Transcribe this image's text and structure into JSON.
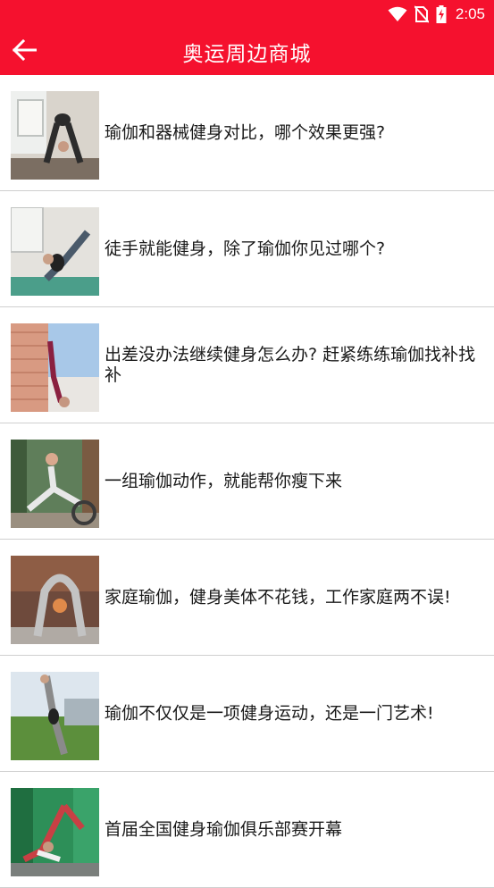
{
  "status": {
    "time": "2:05",
    "icons": [
      "wifi-icon",
      "no-sim-icon",
      "battery-charging-icon"
    ]
  },
  "header": {
    "title": "奥运周边商城",
    "back_icon": "arrow-left-icon"
  },
  "colors": {
    "accent": "#f5112e",
    "divider": "#cfcfcf",
    "text": "#1a1a1a"
  },
  "articles": [
    {
      "title": "瑜伽和器械健身对比，哪个效果更强?",
      "thumb": "yoga-photo-1"
    },
    {
      "title": "徒手就能健身，除了瑜伽你见过哪个?",
      "thumb": "yoga-photo-2"
    },
    {
      "title": "出差没办法继续健身怎么办? 赶紧练练瑜伽找补找补",
      "thumb": "yoga-photo-3"
    },
    {
      "title": "一组瑜伽动作，就能帮你瘦下来",
      "thumb": "yoga-photo-4"
    },
    {
      "title": "家庭瑜伽，健身美体不花钱，工作家庭两不误!",
      "thumb": "yoga-photo-5"
    },
    {
      "title": "瑜伽不仅仅是一项健身运动，还是一门艺术!",
      "thumb": "yoga-photo-6"
    },
    {
      "title": "首届全国健身瑜伽俱乐部赛开幕",
      "thumb": "yoga-photo-7"
    }
  ]
}
